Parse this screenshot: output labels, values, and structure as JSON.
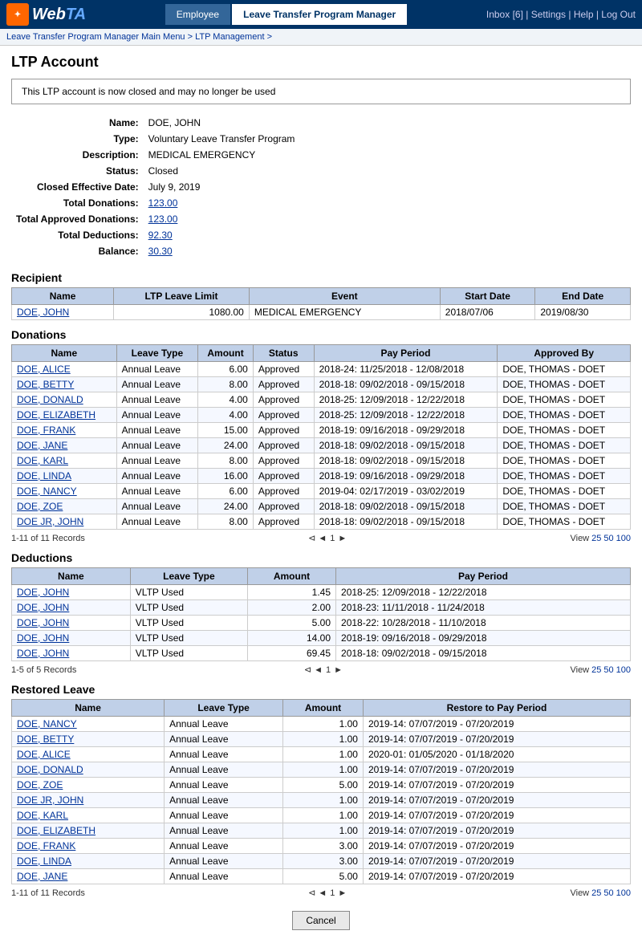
{
  "header": {
    "logo_text": "WebTA",
    "nav_tabs": [
      {
        "label": "Employee",
        "active": false
      },
      {
        "label": "Leave Transfer Program Manager",
        "active": true
      }
    ],
    "header_links": "Inbox [6] | Settings | Help | Log Out"
  },
  "breadcrumb": "Leave Transfer Program Manager Main Menu > LTP Management >",
  "page_title": "LTP Account",
  "alert": "This LTP account is now closed and may no longer be used",
  "account_info": {
    "name_label": "Name:",
    "name_value": "DOE, JOHN",
    "type_label": "Type:",
    "type_value": "Voluntary Leave Transfer Program",
    "description_label": "Description:",
    "description_value": "MEDICAL EMERGENCY",
    "status_label": "Status:",
    "status_value": "Closed",
    "closed_date_label": "Closed Effective Date:",
    "closed_date_value": "July 9, 2019",
    "total_donations_label": "Total Donations:",
    "total_donations_value": "123.00",
    "total_approved_label": "Total Approved Donations:",
    "total_approved_value": "123.00",
    "total_deductions_label": "Total Deductions:",
    "total_deductions_value": "92.30",
    "balance_label": "Balance:",
    "balance_value": "30.30"
  },
  "recipient": {
    "section_title": "Recipient",
    "columns": [
      "Name",
      "LTP Leave Limit",
      "Event",
      "Start Date",
      "End Date"
    ],
    "rows": [
      {
        "name": "DOE, JOHN",
        "limit": "1080.00",
        "event": "MEDICAL EMERGENCY",
        "start": "2018/07/06",
        "end": "2019/08/30"
      }
    ]
  },
  "donations": {
    "section_title": "Donations",
    "columns": [
      "Name",
      "Leave Type",
      "Amount",
      "Status",
      "Pay Period",
      "Approved By"
    ],
    "rows": [
      {
        "name": "DOE, ALICE",
        "leave_type": "Annual Leave",
        "amount": "6.00",
        "status": "Approved",
        "pay_period": "2018-24: 11/25/2018 - 12/08/2018",
        "approved_by": "DOE, THOMAS - DOET"
      },
      {
        "name": "DOE, BETTY",
        "leave_type": "Annual Leave",
        "amount": "8.00",
        "status": "Approved",
        "pay_period": "2018-18: 09/02/2018 - 09/15/2018",
        "approved_by": "DOE, THOMAS - DOET"
      },
      {
        "name": "DOE, DONALD",
        "leave_type": "Annual Leave",
        "amount": "4.00",
        "status": "Approved",
        "pay_period": "2018-25: 12/09/2018 - 12/22/2018",
        "approved_by": "DOE, THOMAS - DOET"
      },
      {
        "name": "DOE, ELIZABETH",
        "leave_type": "Annual Leave",
        "amount": "4.00",
        "status": "Approved",
        "pay_period": "2018-25: 12/09/2018 - 12/22/2018",
        "approved_by": "DOE, THOMAS - DOET"
      },
      {
        "name": "DOE, FRANK",
        "leave_type": "Annual Leave",
        "amount": "15.00",
        "status": "Approved",
        "pay_period": "2018-19: 09/16/2018 - 09/29/2018",
        "approved_by": "DOE, THOMAS - DOET"
      },
      {
        "name": "DOE, JANE",
        "leave_type": "Annual Leave",
        "amount": "24.00",
        "status": "Approved",
        "pay_period": "2018-18: 09/02/2018 - 09/15/2018",
        "approved_by": "DOE, THOMAS - DOET"
      },
      {
        "name": "DOE, KARL",
        "leave_type": "Annual Leave",
        "amount": "8.00",
        "status": "Approved",
        "pay_period": "2018-18: 09/02/2018 - 09/15/2018",
        "approved_by": "DOE, THOMAS - DOET"
      },
      {
        "name": "DOE, LINDA",
        "leave_type": "Annual Leave",
        "amount": "16.00",
        "status": "Approved",
        "pay_period": "2018-19: 09/16/2018 - 09/29/2018",
        "approved_by": "DOE, THOMAS - DOET"
      },
      {
        "name": "DOE, NANCY",
        "leave_type": "Annual Leave",
        "amount": "6.00",
        "status": "Approved",
        "pay_period": "2019-04: 02/17/2019 - 03/02/2019",
        "approved_by": "DOE, THOMAS - DOET"
      },
      {
        "name": "DOE, ZOE",
        "leave_type": "Annual Leave",
        "amount": "24.00",
        "status": "Approved",
        "pay_period": "2018-18: 09/02/2018 - 09/15/2018",
        "approved_by": "DOE, THOMAS - DOET"
      },
      {
        "name": "DOE JR, JOHN",
        "leave_type": "Annual Leave",
        "amount": "8.00",
        "status": "Approved",
        "pay_period": "2018-18: 09/02/2018 - 09/15/2018",
        "approved_by": "DOE, THOMAS - DOET"
      }
    ],
    "pagination": "1-11 of 11 Records",
    "page": "1",
    "view_options": [
      "25",
      "50",
      "100"
    ]
  },
  "deductions": {
    "section_title": "Deductions",
    "columns": [
      "Name",
      "Leave Type",
      "Amount",
      "Pay Period"
    ],
    "rows": [
      {
        "name": "DOE, JOHN",
        "leave_type": "VLTP Used",
        "amount": "1.45",
        "pay_period": "2018-25: 12/09/2018 - 12/22/2018"
      },
      {
        "name": "DOE, JOHN",
        "leave_type": "VLTP Used",
        "amount": "2.00",
        "pay_period": "2018-23: 11/11/2018 - 11/24/2018"
      },
      {
        "name": "DOE, JOHN",
        "leave_type": "VLTP Used",
        "amount": "5.00",
        "pay_period": "2018-22: 10/28/2018 - 11/10/2018"
      },
      {
        "name": "DOE, JOHN",
        "leave_type": "VLTP Used",
        "amount": "14.00",
        "pay_period": "2018-19: 09/16/2018 - 09/29/2018"
      },
      {
        "name": "DOE, JOHN",
        "leave_type": "VLTP Used",
        "amount": "69.45",
        "pay_period": "2018-18: 09/02/2018 - 09/15/2018"
      }
    ],
    "pagination": "1-5 of 5 Records",
    "page": "1",
    "view_options": [
      "25",
      "50",
      "100"
    ]
  },
  "restored_leave": {
    "section_title": "Restored Leave",
    "columns": [
      "Name",
      "Leave Type",
      "Amount",
      "Restore to Pay Period"
    ],
    "rows": [
      {
        "name": "DOE, NANCY",
        "leave_type": "Annual Leave",
        "amount": "1.00",
        "pay_period": "2019-14: 07/07/2019 - 07/20/2019"
      },
      {
        "name": "DOE, BETTY",
        "leave_type": "Annual Leave",
        "amount": "1.00",
        "pay_period": "2019-14: 07/07/2019 - 07/20/2019"
      },
      {
        "name": "DOE, ALICE",
        "leave_type": "Annual Leave",
        "amount": "1.00",
        "pay_period": "2020-01: 01/05/2020 - 01/18/2020"
      },
      {
        "name": "DOE, DONALD",
        "leave_type": "Annual Leave",
        "amount": "1.00",
        "pay_period": "2019-14: 07/07/2019 - 07/20/2019"
      },
      {
        "name": "DOE, ZOE",
        "leave_type": "Annual Leave",
        "amount": "5.00",
        "pay_period": "2019-14: 07/07/2019 - 07/20/2019"
      },
      {
        "name": "DOE JR, JOHN",
        "leave_type": "Annual Leave",
        "amount": "1.00",
        "pay_period": "2019-14: 07/07/2019 - 07/20/2019"
      },
      {
        "name": "DOE, KARL",
        "leave_type": "Annual Leave",
        "amount": "1.00",
        "pay_period": "2019-14: 07/07/2019 - 07/20/2019"
      },
      {
        "name": "DOE, ELIZABETH",
        "leave_type": "Annual Leave",
        "amount": "1.00",
        "pay_period": "2019-14: 07/07/2019 - 07/20/2019"
      },
      {
        "name": "DOE, FRANK",
        "leave_type": "Annual Leave",
        "amount": "3.00",
        "pay_period": "2019-14: 07/07/2019 - 07/20/2019"
      },
      {
        "name": "DOE, LINDA",
        "leave_type": "Annual Leave",
        "amount": "3.00",
        "pay_period": "2019-14: 07/07/2019 - 07/20/2019"
      },
      {
        "name": "DOE, JANE",
        "leave_type": "Annual Leave",
        "amount": "5.00",
        "pay_period": "2019-14: 07/07/2019 - 07/20/2019"
      }
    ],
    "pagination": "1-11 of 11 Records",
    "page": "1",
    "view_options": [
      "25",
      "50",
      "100"
    ]
  },
  "cancel_button": "Cancel"
}
